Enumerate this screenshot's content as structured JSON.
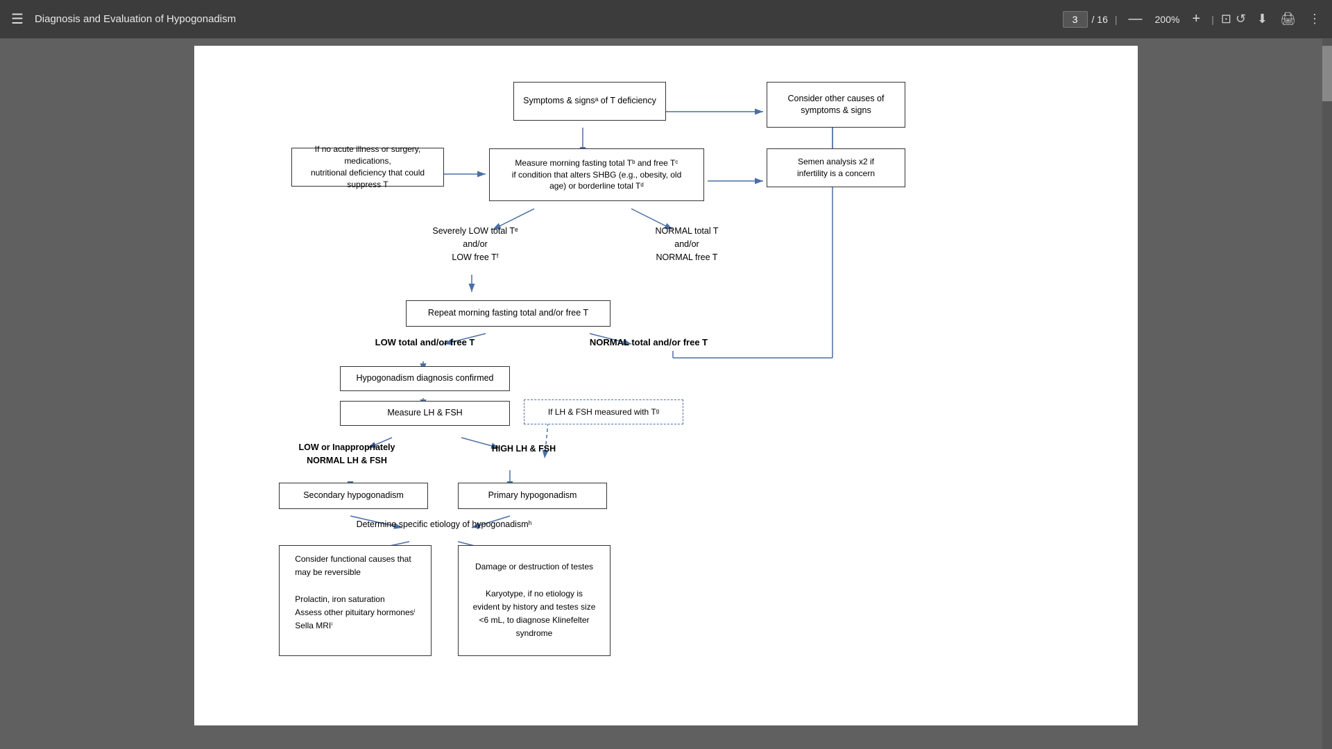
{
  "toolbar": {
    "menu_label": "☰",
    "title": "Diagnosis and Evaluation of Hypogonadism",
    "page_current": "3",
    "page_total": "16",
    "zoom_minus": "—",
    "zoom_value": "200%",
    "zoom_plus": "+",
    "fit_icon": "⊡",
    "rotate_icon": "↺",
    "download_icon": "⬇",
    "print_icon": "🖨",
    "more_icon": "⋮"
  },
  "flowchart": {
    "box_symptoms": "Symptoms & signsᵃ of T deficiency",
    "box_consider_other": "Consider other causes of\nsymptoms & signs",
    "box_no_acute": "If no acute illness or surgery, medications,\nnutritional deficiency that could suppress T",
    "box_measure_morning": "Measure morning fasting total Tᵇ and free Tᶜ\nif condition that alters SHBG (e.g., obesity, old\nage) or borderline total Tᵈ",
    "box_semen": "Semen analysis x2 if\ninfertility is a concern",
    "text_severely_low": "Severely LOW total Tᵉ\nand/or\nLOW free Tᶠ",
    "text_normal": "NORMAL total T\nand/or\nNORMAL free T",
    "box_repeat": "Repeat morning fasting total and/or free T",
    "text_low_total": "LOW total and/or free T",
    "text_normal_total": "NORMAL total and/or free T",
    "box_hypo_confirmed": "Hypogonadism diagnosis confirmed",
    "box_measure_lh": "Measure LH & FSH",
    "box_if_lh_fsh": "If LH & FSH measured with Tᵍ",
    "text_low_or_inappropriate": "LOW or Inappropriately\nNORMAL LH & FSH",
    "text_high_lh": "HIGH LH & FSH",
    "box_secondary": "Secondary hypogonadism",
    "box_primary": "Primary hypogonadism",
    "text_determine": "Determine specific etiology of hypogonadismʰ",
    "box_consider_functional": "Consider functional causes that\nmay be reversible\n\nProlactin, iron saturation\nAssess other pituitary hormonesⁱ\nSella MRIⁱ",
    "box_damage": "Damage or destruction of testes\n\nKaryotype, if no etiology is\nevident by history and testes size\n<6 mL, to diagnose Klinefelter\nsyndrome"
  }
}
